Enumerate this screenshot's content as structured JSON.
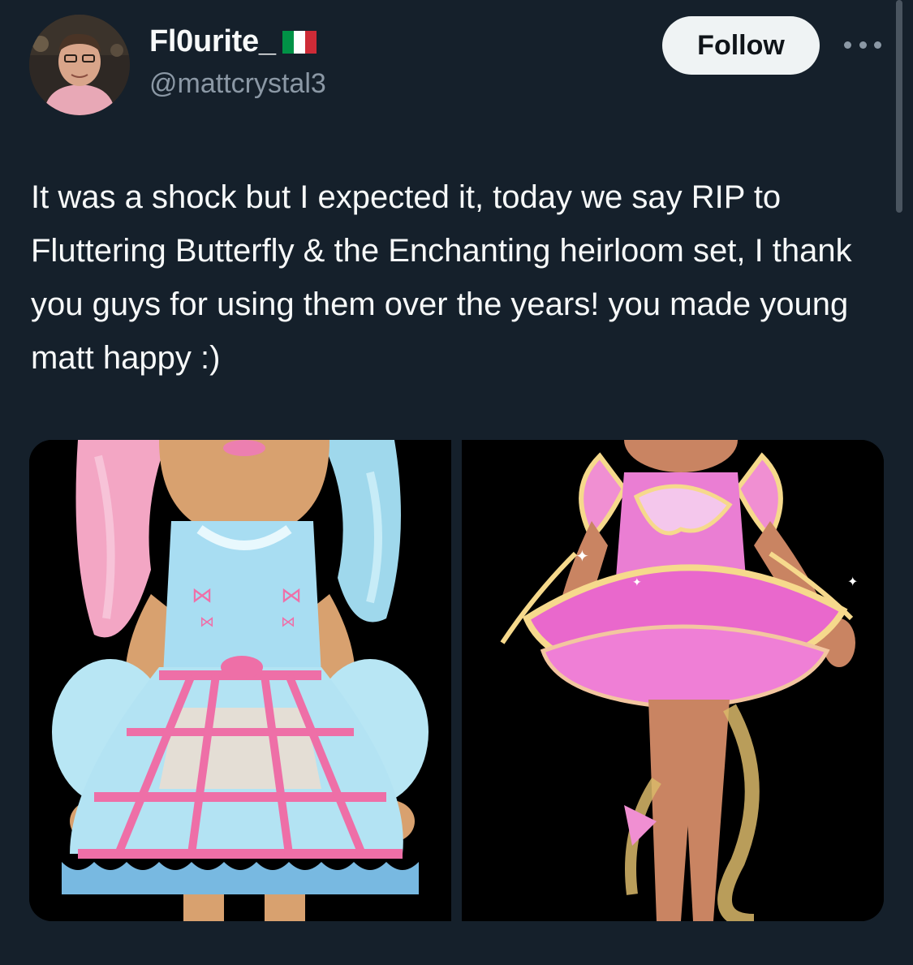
{
  "author": {
    "display_name": "Fl0urite_",
    "flag_icon": "italy-flag-icon",
    "handle": "@mattcrystal3",
    "flag_colors": [
      "#009246",
      "#ffffff",
      "#ce2b37"
    ]
  },
  "actions": {
    "follow_label": "Follow",
    "more_icon": "more-horizontal-icon"
  },
  "tweet": {
    "text": "It was a shock but I expected it, today we say RIP to Fluttering Butterfly & the Enchanting heirloom set, I thank you guys for using them over the years! you made young matt happy :)"
  },
  "media": {
    "photos": [
      {
        "subject": "blue and pink cage-skirt dress on avatar"
      },
      {
        "subject": "pink and gold butterfly dress on avatar"
      }
    ]
  },
  "colors": {
    "background": "#15202b",
    "text_primary": "#f7f9f9",
    "text_secondary": "#8b98a5",
    "follow_bg": "#eff3f4"
  }
}
